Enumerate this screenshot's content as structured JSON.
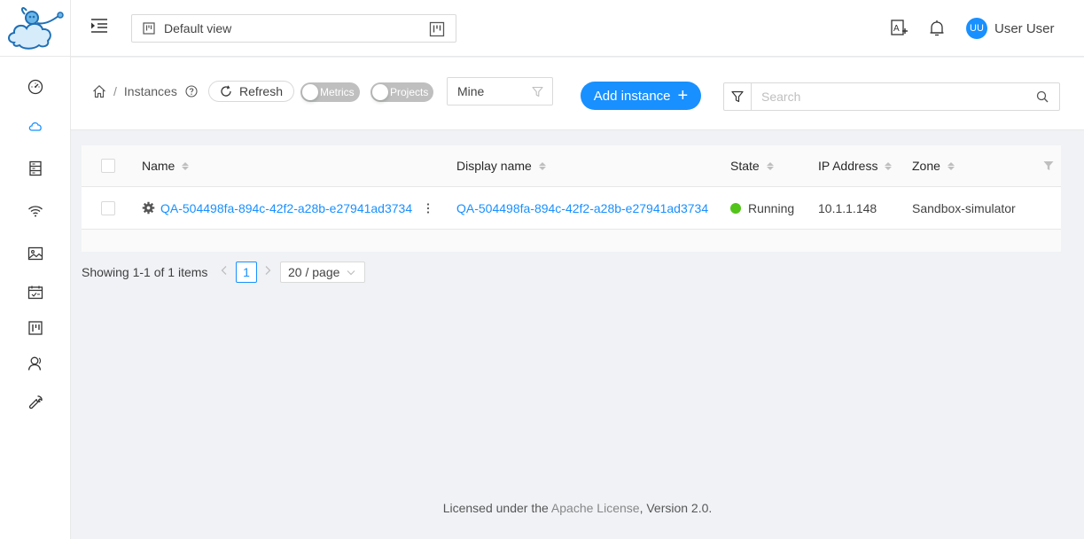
{
  "header": {
    "view_select": "Default view",
    "user_initials": "UU",
    "user_name": "User User"
  },
  "toolbar": {
    "breadcrumb": {
      "separator": "/",
      "current": "Instances"
    },
    "refresh_label": "Refresh",
    "metrics_label": "Metrics",
    "projects_label": "Projects",
    "filter_value": "Mine",
    "add_label": "Add instance",
    "search_placeholder": "Search"
  },
  "table": {
    "columns": {
      "name": "Name",
      "display_name": "Display name",
      "state": "State",
      "ip": "IP Address",
      "zone": "Zone"
    },
    "rows": [
      {
        "name": "QA-504498fa-894c-42f2-a28b-e27941ad3734",
        "display_name": "QA-504498fa-894c-42f2-a28b-e27941ad3734",
        "state": "Running",
        "ip": "10.1.1.148",
        "zone": "Sandbox-simulator"
      }
    ]
  },
  "pagination": {
    "total_text": "Showing 1-1 of 1 items",
    "current_page": "1",
    "page_size": "20 / page"
  },
  "footer": {
    "prefix": "Licensed under the",
    "link": "Apache License",
    "suffix": ", Version 2.0."
  },
  "colors": {
    "primary": "#1890ff",
    "running": "#52c41a"
  }
}
